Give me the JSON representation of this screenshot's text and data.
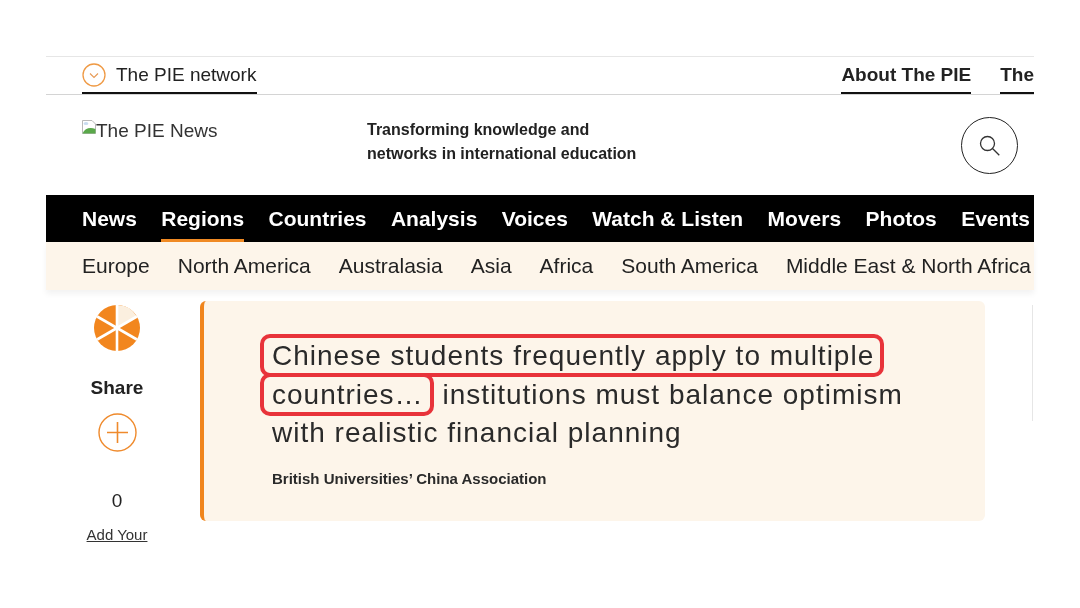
{
  "network_bar": {
    "network_menu": {
      "label": "The PIE network"
    },
    "links": [
      "About The PIE",
      "The"
    ]
  },
  "header": {
    "logo_alt_text": "The PIE News",
    "tagline": "Transforming knowledge and networks in international education"
  },
  "main_nav": [
    {
      "label": "News",
      "selected": false
    },
    {
      "label": "Regions",
      "selected": true
    },
    {
      "label": "Countries",
      "selected": false
    },
    {
      "label": "Analysis",
      "selected": false
    },
    {
      "label": "Voices",
      "selected": false
    },
    {
      "label": "Watch & Listen",
      "selected": false
    },
    {
      "label": "Movers",
      "selected": false
    },
    {
      "label": "Photos",
      "selected": false
    },
    {
      "label": "Events",
      "selected": false
    }
  ],
  "regions_subnav": [
    "Europe",
    "North America",
    "Australasia",
    "Asia",
    "Africa",
    "South America",
    "Middle East & North Africa"
  ],
  "share_sidebar": {
    "label": "Share",
    "comment_count": "0",
    "comment_link": "Add Your"
  },
  "pull_quote": {
    "segments": [
      {
        "text": "Chinese students frequently apply to multiple",
        "highlighted": true
      },
      {
        "text": "countries…",
        "highlighted": true
      },
      {
        "text": "institutions must balance optimism with realistic financial planning",
        "highlighted": false
      }
    ],
    "attribution": "British Universities’ China Association"
  }
}
